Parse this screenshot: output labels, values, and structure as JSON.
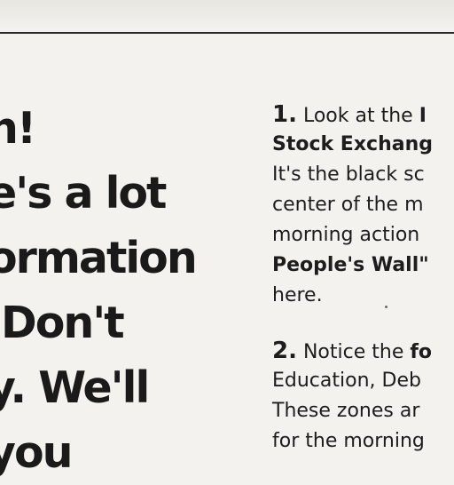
{
  "heading": {
    "lines": [
      "n!",
      "e's a lot",
      "ormation",
      " Don't",
      "y. We'll",
      "you"
    ]
  },
  "steps": [
    {
      "number": "1.",
      "line1_text": "Look at the ",
      "line1_bold": "I",
      "line2_bold": "Stock Exchang",
      "line3": "It's the black sc",
      "line4": "center of the m",
      "line5": "morning action",
      "line6_bold": "People's Wall\"",
      "line7": "here."
    },
    {
      "number": "2.",
      "line1_text": "Notice the ",
      "line1_bold": "fo",
      "line2": "Education, Deb",
      "line3": "These zones ar",
      "line4": "for the morning"
    }
  ]
}
